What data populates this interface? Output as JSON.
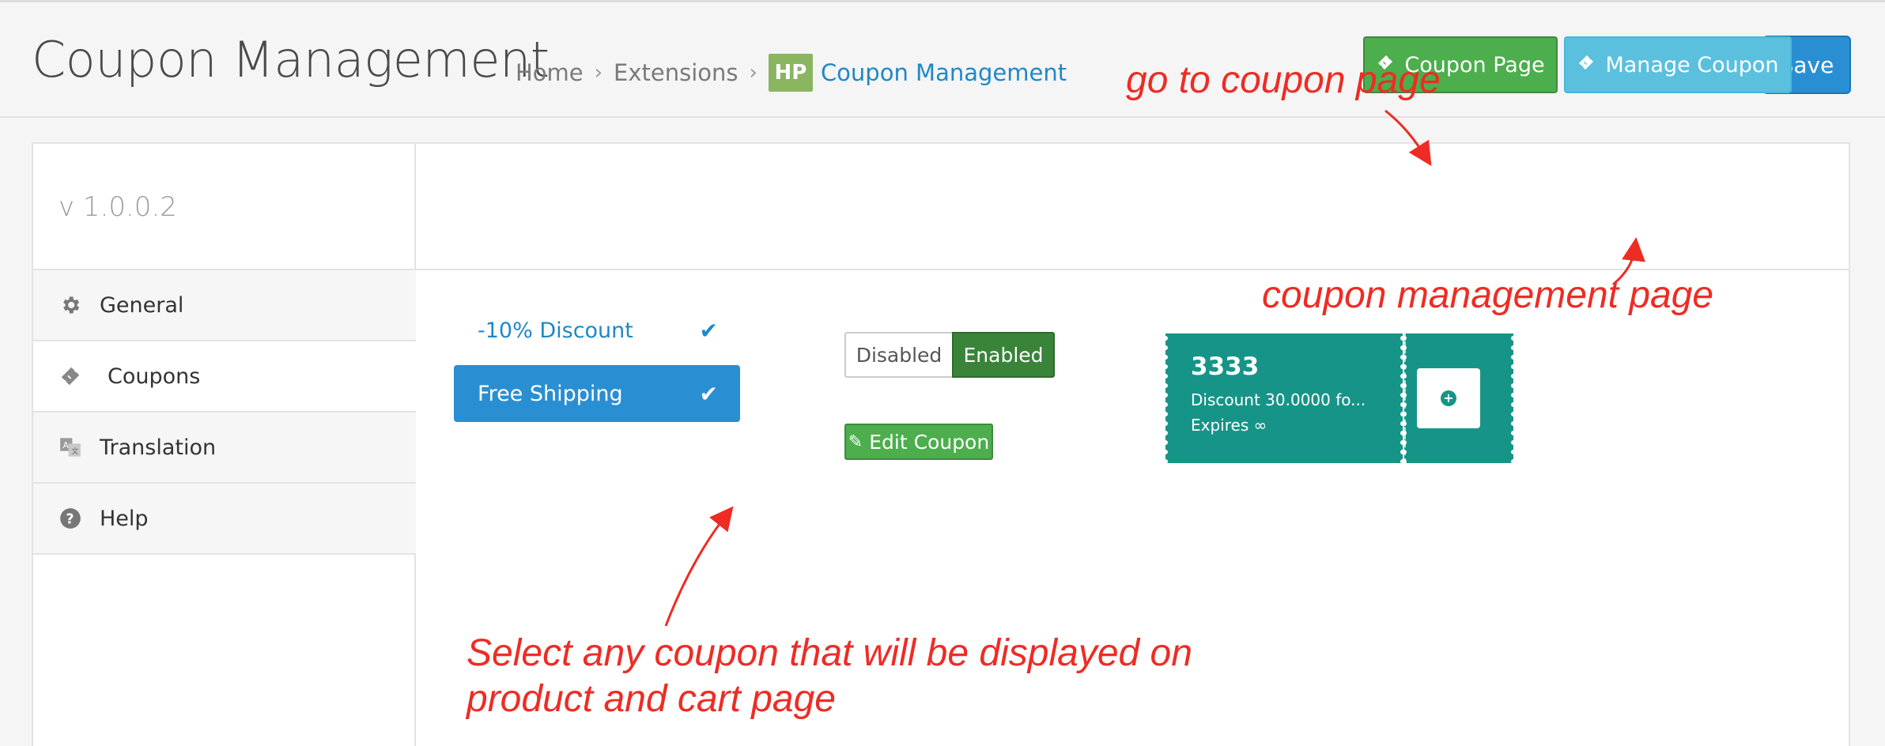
{
  "header": {
    "title": "Coupon Management",
    "breadcrumb": [
      "Home",
      "Extensions",
      "Coupon Management"
    ],
    "logo_text": "HP",
    "save_label": "Save"
  },
  "sidebar": {
    "version": "v 1.0.0.2",
    "items": [
      {
        "label": "General",
        "icon": "gear-icon"
      },
      {
        "label": "Coupons",
        "icon": "ticket-icon"
      },
      {
        "label": "Translation",
        "icon": "translate-icon"
      },
      {
        "label": "Help",
        "icon": "question-icon"
      }
    ]
  },
  "toolbar": {
    "coupon_page_label": "Coupon Page",
    "manage_coupon_label": "Manage Coupon"
  },
  "coupons": {
    "options": [
      "-10% Discount",
      "Free Shipping"
    ],
    "selected": "Free Shipping",
    "toggle_disabled": "Disabled",
    "toggle_enabled": "Enabled",
    "edit_label": "Edit Coupon"
  },
  "ticket": {
    "code": "3333",
    "description": "Discount 30.0000 fo...",
    "expires": "Expires ∞"
  },
  "annotations": {
    "coupon_page": "go to coupon page",
    "management_page": "coupon management page",
    "select_line1": "Select any coupon that will be displayed on",
    "select_line2": "product and cart page"
  },
  "colors": {
    "primary": "#2a8ed3",
    "success": "#4cae4c",
    "info": "#5bc0de",
    "teal": "#179488",
    "annotation": "#ee2c24"
  }
}
